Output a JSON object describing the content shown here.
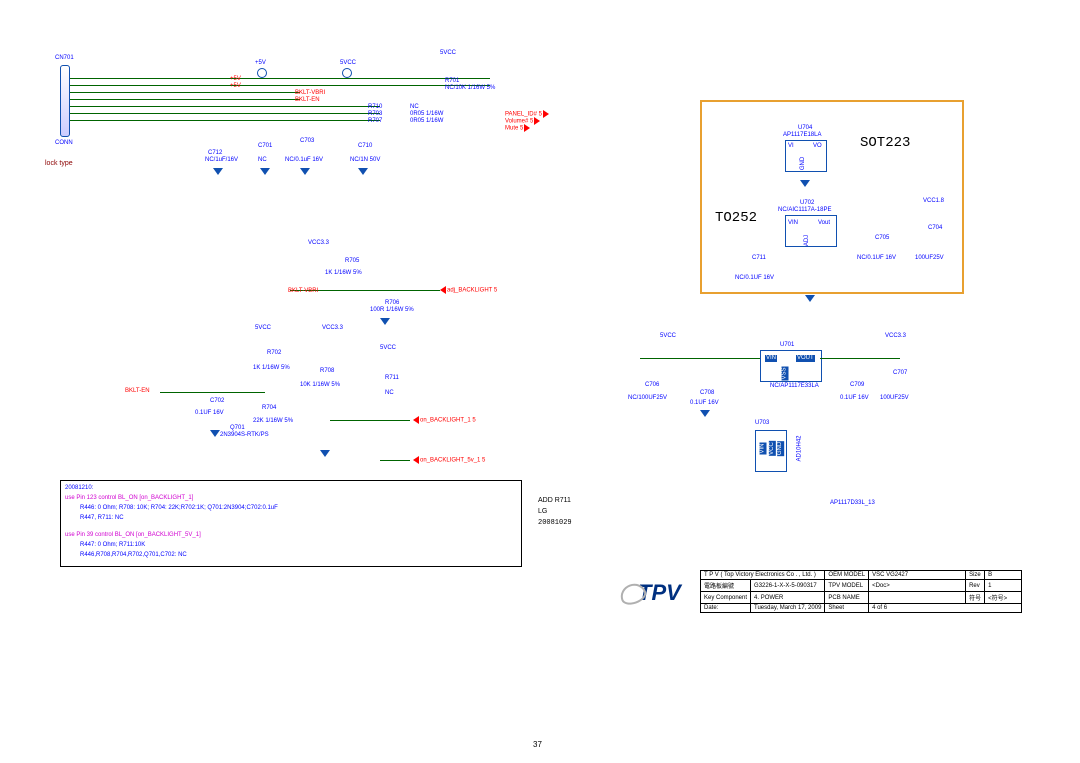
{
  "page_number": "37",
  "labels": {
    "cn701": "CN701",
    "conn_text": "CONN",
    "lock_type": "lock type",
    "p5v_a": "+5V",
    "p5v_b": "+5V",
    "vcc_a": "5VCC",
    "vcc_b": "5VCC",
    "vcc_c": "5VCC",
    "vcc_d": "5VCC",
    "vcc_e": "5VCC",
    "vcc33_a": "VCC3.3",
    "vcc33_b": "VCC3.3",
    "vcc33_c": "VCC3.3",
    "vcc18": "VCC1.8",
    "sot223": "SOT223",
    "to252": "TO252",
    "add_r711": "ADD R711",
    "lg": "LG",
    "date1": "20081029",
    "hdr_date": "20081210:",
    "use1": "use Pin 123 control BL_ON [on_BACKLIGHT_1]",
    "use1a": "R446: 0 Ohm; R708: 10K; R704: 22K;R702:1K; Q701:2N3904;C702:0.1uF",
    "use1b": "R447, R711: NC",
    "use2": "use Pin 39 control BL_ON [on_BACKLIGHT_5V_1]",
    "use2a": "R447: 0 Ohm; R711:10K",
    "use2b": "R446,R708,R704,R702,Q701,C702: NC"
  },
  "components": {
    "r701": "R701",
    "r701v": "NC/10K 1/16W 5%",
    "r702": "R702",
    "r702v": "1K 1/16W 5%",
    "r703": "R703",
    "r703v": "0R05 1/16W",
    "r704": "R704",
    "r704v": "22K 1/16W 5%",
    "r705": "R705",
    "r705v": "1K 1/16W 5%",
    "r706": "R706",
    "r706v": "100R 1/16W 5%",
    "r707": "R707",
    "r707v": "0R05 1/16W",
    "r708": "R708",
    "r708v": "10K 1/16W 5%",
    "r710": "R710",
    "r710v": "NC",
    "r711": "R711",
    "r711v": "NC",
    "c701": "C701",
    "c701v": "NC",
    "c702": "C702",
    "c702v": "0.1UF 16V",
    "c703": "C703",
    "c703v": "NC/0.1uF 16V",
    "c704": "C704",
    "c704v": "100UF25V",
    "c705": "C705",
    "c705v": "NC/0.1UF 16V",
    "c706": "C706",
    "c706v": "NC/100UF25V",
    "c707": "C707",
    "c707v": "100UF25V",
    "c708a": "C708",
    "c708av": "0.1UF 16V",
    "c709": "C709",
    "c709v": "0.1UF 16V",
    "c710": "C710",
    "c710v": "NC/1N 50V",
    "c711": "C711",
    "c711v": "NC/0.1UF 16V",
    "c712": "C712",
    "c712v": "NC/1uF/16V",
    "q701": "Q701",
    "q701v": "2N3904S-RTK/PS",
    "u701": "U701",
    "u701v": "NC/AP1117E33LA",
    "u702": "U702",
    "u702v": "NC/AIC1117A-18PE",
    "u703": "U703",
    "u703v": "AD10H42",
    "u704": "U704",
    "u704v": "AP1117E18LA",
    "footnote": "AP1117D33L_13"
  },
  "nets": {
    "bklt_vbri": "BKLT-VBRI",
    "bklt_en": "BKLT-EN",
    "panel_id": "PANEL_ID# 5",
    "volume": "Volume# 5",
    "mute": "Mute 5",
    "adj_bl": "adj_BACKLIGHT 5",
    "on_bl1": "on_BACKLIGHT_1 5",
    "on_bl5v1": "on_BACKLIGHT_5v_1 5",
    "vin": "VIN",
    "vout": "VOUT",
    "vi": "VI",
    "vo": "VO",
    "vss": "VSS",
    "adj": "ADJ",
    "gnd": "GND",
    "vcc": "VCC"
  },
  "title_block": {
    "row1a": "T P V  ( Top   Victory   Electronics   Co .  , Ltd. )",
    "row1b": "OEM MODEL",
    "row1c": "VSC VG2427",
    "row1d": "Size",
    "row1e": "B",
    "row2a": "電路板編號",
    "row2b": "G3226-1-X-X-5-090317",
    "row2c": "TPV MODEL",
    "row2d": "<Doc>",
    "row2e": "Rev",
    "row2f": "1",
    "row3a": "Key Component",
    "row3b": "4. POWER",
    "row3c": "PCB NAME",
    "row3d": "",
    "row3e": "符号",
    "row3f": "<符号>",
    "row4a": "Date:",
    "row4b": "Tuesday, March 17, 2009",
    "row4c": "Sheet",
    "row4d": "4   of   6"
  },
  "logo": "TPV"
}
